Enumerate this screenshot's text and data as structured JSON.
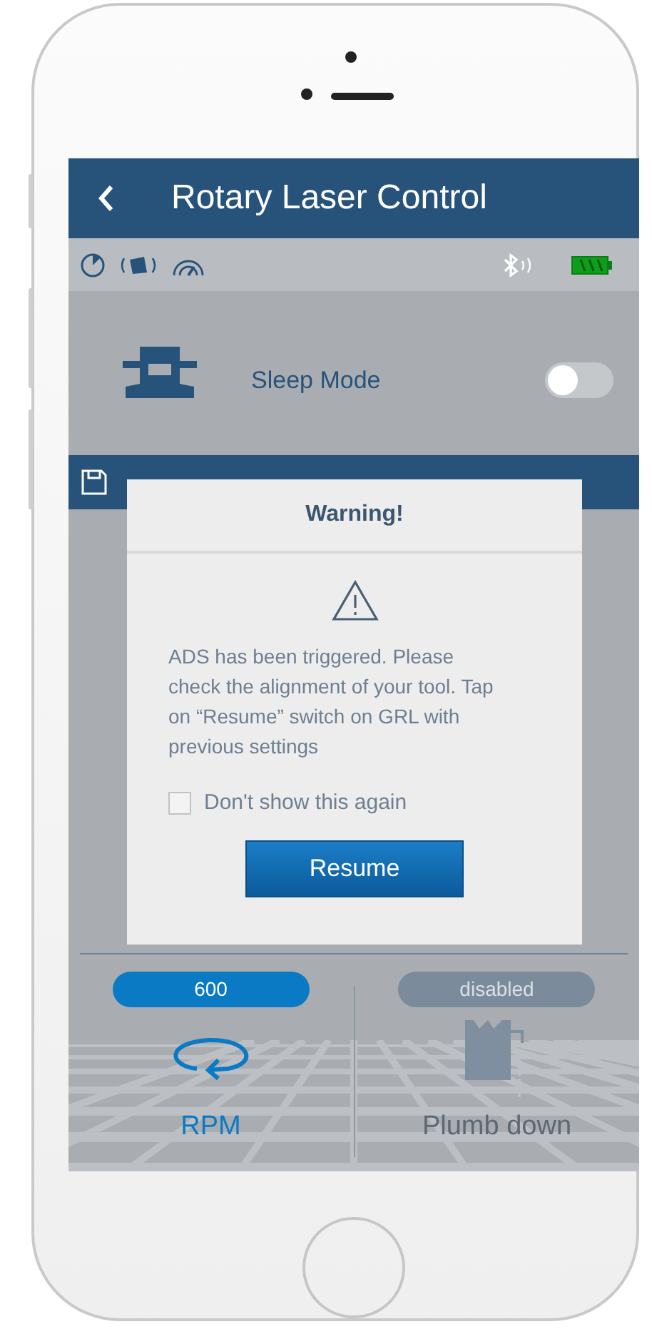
{
  "header": {
    "title": "Rotary Laser Control"
  },
  "sleep_mode": {
    "label": "Sleep Mode",
    "on": false
  },
  "dialog": {
    "title": "Warning!",
    "message": "ADS has been triggered. Please check the alignment of your tool. Tap on “Resume” switch on GRL with previous settings",
    "checkbox": {
      "label": "Don't show this again",
      "checked": false
    },
    "button": "Resume"
  },
  "controls": [
    {
      "kind": "rpm",
      "badge": "600",
      "label": "RPM",
      "disabled": false
    },
    {
      "kind": "plumb",
      "badge": "disabled",
      "label": "Plumb down",
      "disabled": true
    }
  ]
}
